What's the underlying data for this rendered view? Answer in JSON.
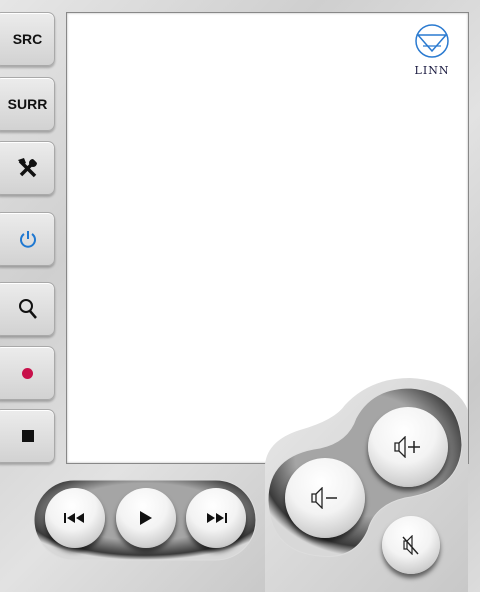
{
  "sidebar": {
    "items": [
      {
        "label": "SRC",
        "icon": "text"
      },
      {
        "label": "SURR",
        "icon": "text"
      },
      {
        "label": "",
        "icon": "tools-icon"
      },
      {
        "label": "",
        "icon": "power-icon",
        "color": "#1f78d1"
      },
      {
        "label": "",
        "icon": "search-icon"
      },
      {
        "label": "",
        "icon": "record-icon",
        "color": "#c8104a"
      },
      {
        "label": "",
        "icon": "stop-icon"
      }
    ]
  },
  "screen": {
    "logo_text": "LINN"
  },
  "transport": {
    "buttons": [
      "previous-icon",
      "play-icon",
      "next-icon"
    ]
  },
  "volume": {
    "buttons": [
      "volume-down-icon",
      "volume-up-icon",
      "mute-icon"
    ]
  }
}
